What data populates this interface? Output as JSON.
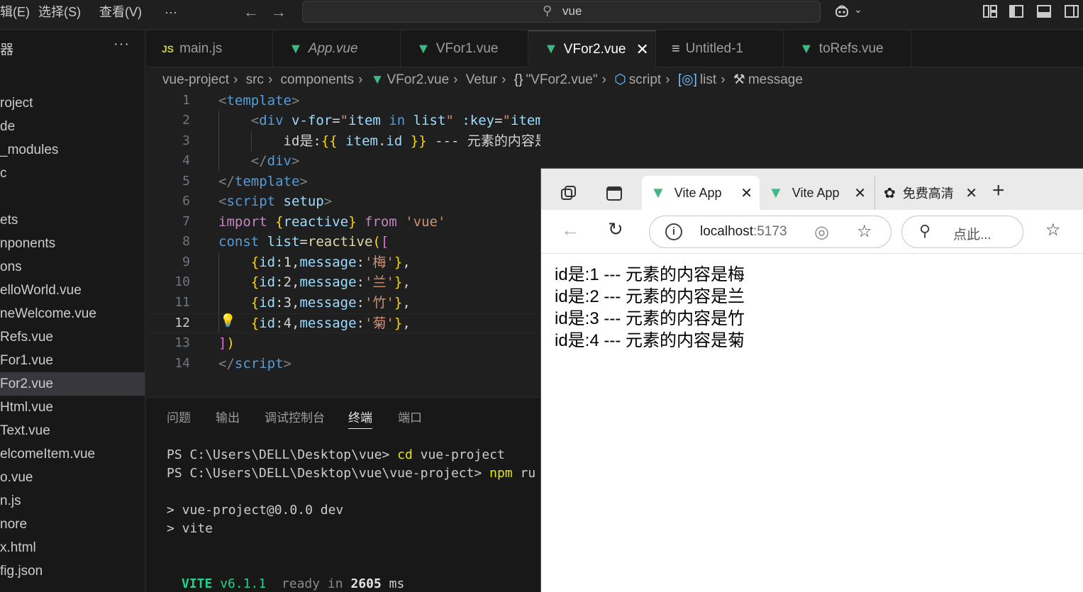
{
  "titlebar": {
    "menus": [
      "辑(E)",
      "选择(S)",
      "查看(V)",
      "···"
    ],
    "search_text": "vue"
  },
  "sidebar": {
    "header": "器",
    "more": "···",
    "items": [
      {
        "label": "roject",
        "active": false
      },
      {
        "label": "de",
        "active": false
      },
      {
        "label": "_modules",
        "active": false
      },
      {
        "label": "c",
        "active": false
      },
      {
        "label": "",
        "active": false
      },
      {
        "label": "ets",
        "active": false
      },
      {
        "label": "nponents",
        "active": false
      },
      {
        "label": "ons",
        "active": false
      },
      {
        "label": "elloWorld.vue",
        "active": false
      },
      {
        "label": "neWelcome.vue",
        "active": false
      },
      {
        "label": "Refs.vue",
        "active": false
      },
      {
        "label": "For1.vue",
        "active": false
      },
      {
        "label": "For2.vue",
        "active": true
      },
      {
        "label": "Html.vue",
        "active": false
      },
      {
        "label": "Text.vue",
        "active": false
      },
      {
        "label": "elcomeItem.vue",
        "active": false
      },
      {
        "label": "o.vue",
        "active": false
      },
      {
        "label": "n.js",
        "active": false
      },
      {
        "label": "nore",
        "active": false
      },
      {
        "label": "x.html",
        "active": false
      },
      {
        "label": "fig.json",
        "active": false
      }
    ]
  },
  "tabs": [
    {
      "label": "main.js",
      "icon": "JS"
    },
    {
      "label": "App.vue",
      "icon": "V"
    },
    {
      "label": "VFor1.vue",
      "icon": "V"
    },
    {
      "label": "VFor2.vue",
      "icon": "V",
      "active": true
    },
    {
      "label": "Untitled-1",
      "icon": "≡"
    },
    {
      "label": "toRefs.vue",
      "icon": "V"
    }
  ],
  "breadcrumb": [
    "vue-project",
    "src",
    "components",
    "VFor2.vue",
    "Vetur",
    "\"VFor2.vue\"",
    "script",
    "list",
    "message"
  ],
  "editor": {
    "line_numbers": [
      "1",
      "2",
      "3",
      "4",
      "5",
      "6",
      "7",
      "8",
      "9",
      "10",
      "11",
      "12",
      "13",
      "14"
    ],
    "current_line": "12"
  },
  "panel": {
    "tabs": [
      "问题",
      "输出",
      "调试控制台",
      "终端",
      "端口"
    ],
    "active_tab": "终端",
    "terminal": {
      "l1_prompt": "PS C:\\Users\\DELL\\Desktop\\vue> ",
      "l1_cmd": "cd",
      "l1_arg": " vue-project",
      "l2_prompt": "PS C:\\Users\\DELL\\Desktop\\vue\\vue-project> ",
      "l2_cmd": "npm",
      "l2_arg": " ru",
      "l3": "> vue-project@0.0.0 dev",
      "l4": "> vite",
      "vite_name": "VITE",
      "vite_ver": " v6.1.1",
      "ready": "  ready in ",
      "ms_value": "2605",
      "ms_unit": " ms"
    }
  },
  "browser": {
    "tabs": [
      {
        "label": "Vite App",
        "active": true
      },
      {
        "label": "Vite App",
        "active": false
      },
      {
        "label": "免费高清",
        "active": false
      }
    ],
    "url_host": "localhost",
    "url_port": ":5173",
    "search_placeholder": "点此...",
    "content": [
      "id是:1 --- 元素的内容是梅",
      "id是:2 --- 元素的内容是兰",
      "id是:3 --- 元素的内容是竹",
      "id是:4 --- 元素的内容是菊"
    ]
  },
  "colors": {
    "accent": "#0078d4",
    "vue_green": "#41b883",
    "editor_bg": "#1f1f1f"
  }
}
